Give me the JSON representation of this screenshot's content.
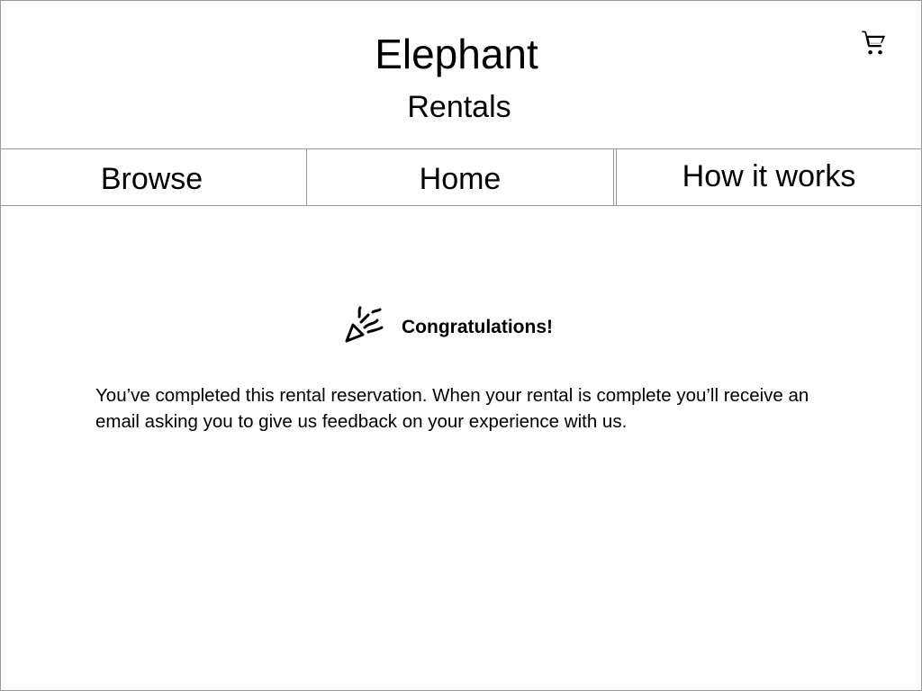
{
  "header": {
    "title": "Elephant",
    "subtitle": "Rentals",
    "cart_icon": "shopping-cart-icon"
  },
  "nav": {
    "tabs": [
      {
        "label": "Browse"
      },
      {
        "label": "Home"
      },
      {
        "label": "How it works"
      }
    ]
  },
  "confirmation": {
    "icon": "party-popper-icon",
    "heading": "Congratulations!",
    "message": "You’ve completed this rental reservation. When your rental is complete you’ll receive an email asking you to give us feedback on your experience with us."
  },
  "colors": {
    "border": "#9a9a9a",
    "text": "#000000",
    "background": "#ffffff"
  }
}
